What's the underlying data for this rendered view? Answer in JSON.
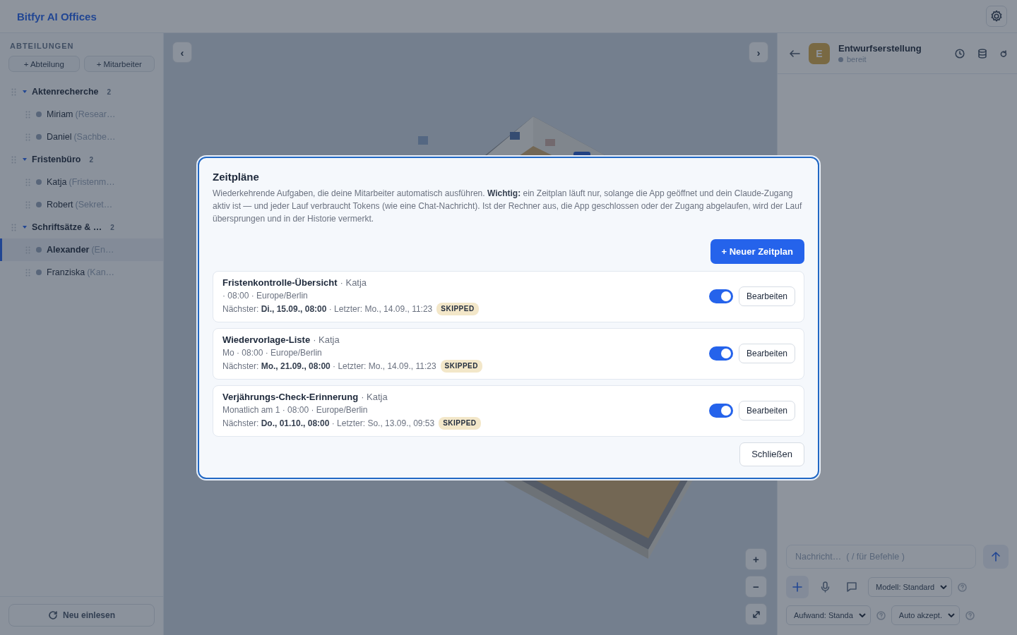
{
  "header": {
    "title": "Bitfyr AI Offices"
  },
  "sidebar": {
    "heading": "ABTEILUNGEN",
    "buttons": [
      "+ Abteilung",
      "+ Mitarbeiter"
    ],
    "departments": [
      {
        "name": "Aktenrecherche",
        "count": "2",
        "expanded": true,
        "children": [
          {
            "name": "Miriam",
            "role": "(Resear…",
            "selected": false
          },
          {
            "name": "Daniel",
            "role": "(Sachbe…",
            "selected": false
          }
        ]
      },
      {
        "name": "Fristenbüro",
        "count": "2",
        "expanded": true,
        "children": [
          {
            "name": "Katja",
            "role": "(Fristenm…",
            "selected": false
          },
          {
            "name": "Robert",
            "role": "(Sekret…",
            "selected": false
          }
        ]
      },
      {
        "name": "Schriftsätze & …",
        "count": "2",
        "expanded": true,
        "children": [
          {
            "name": "Alexander",
            "role": "(En…",
            "selected": true
          },
          {
            "name": "Franziska",
            "role": "(Kan…",
            "selected": false
          }
        ]
      }
    ],
    "reload_button": "Neu einlesen"
  },
  "canvas": {
    "nav_buttons": [
      "‹",
      "›"
    ],
    "zoom_buttons": [
      "+",
      "−"
    ]
  },
  "chat": {
    "agent": {
      "initial": "E",
      "name": "Entwurfserstellung",
      "status": "bereit"
    },
    "input": {
      "placeholder": "Nachricht…  ( / für Befehle )"
    },
    "model_select": "Modell: Standard",
    "effort_select": "Aufwand: Standa",
    "accept_select": "Auto akzept."
  },
  "modal": {
    "title": "Zeitpläne",
    "description": "Wiederkehrende Aufgaben, die deine Mitarbeiter automatisch ausführen. **Wichtig:** ein Zeitplan läuft nur, solange die App geöffnet und dein Claude-Zugang aktiv ist — und jeder Lauf verbraucht Tokens (wie eine Chat-Nachricht). Ist der Rechner aus, die App geschlossen oder der Zugang abgelaufen, wird der Lauf übersprungen und in der Historie vermerkt.",
    "new_button": "+ Neuer Zeitplan",
    "schedules": [
      {
        "name": "Fristenkontrolle-Übersicht",
        "owner": "· Katja",
        "recurrence": "· 08:00 · Europe/Berlin",
        "runs": "Nächster: **Di., 15.09., 08:00** · Letzter: Mo., 14.09., 11:23",
        "status": "SKIPPED",
        "enabled": true,
        "edit_button": "Bearbeiten"
      },
      {
        "name": "Wiedervorlage-Liste",
        "owner": "· Katja",
        "recurrence": "Mo · 08:00 · Europe/Berlin",
        "runs": "Nächster: **Mo., 21.09., 08:00** · Letzter: Mo., 14.09., 11:23",
        "status": "SKIPPED",
        "enabled": true,
        "edit_button": "Bearbeiten"
      },
      {
        "name": "Verjährungs-Check-Erinnerung",
        "owner": "· Katja",
        "recurrence": "Monatlich am 1 · 08:00 · Europe/Berlin",
        "runs": "Nächster: **Do., 01.10., 08:00** · Letzter: So., 13.09., 09:53",
        "status": "SKIPPED",
        "enabled": true,
        "edit_button": "Bearbeiten"
      }
    ],
    "close_button": "Schließen"
  }
}
